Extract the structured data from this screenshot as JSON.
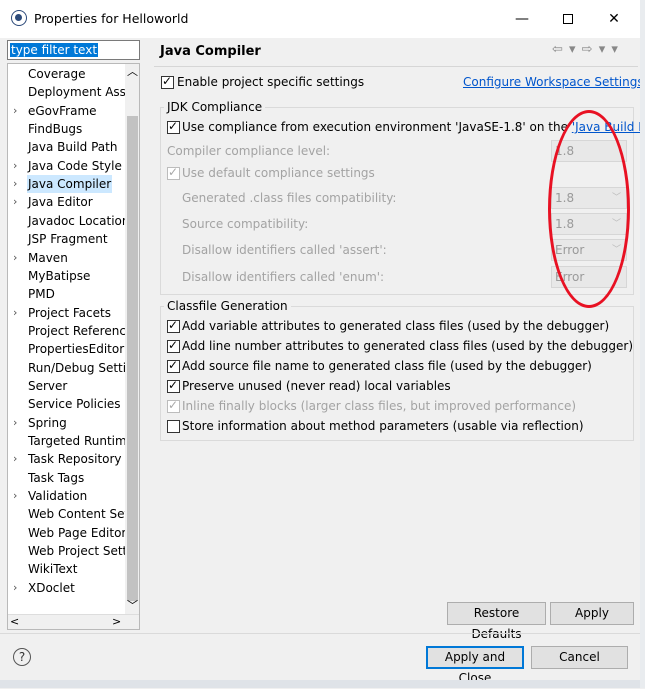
{
  "window": {
    "title": "Properties for Helloworld",
    "controls": {
      "minimize": "—",
      "maximize": "□",
      "close": "✕"
    }
  },
  "filter": {
    "value": "type filter text"
  },
  "tree": {
    "items": [
      {
        "label": "Coverage",
        "expandable": false
      },
      {
        "label": "Deployment Asser",
        "expandable": false
      },
      {
        "label": "eGovFrame",
        "expandable": true
      },
      {
        "label": "FindBugs",
        "expandable": false
      },
      {
        "label": "Java Build Path",
        "expandable": false
      },
      {
        "label": "Java Code Style",
        "expandable": true
      },
      {
        "label": "Java Compiler",
        "expandable": true,
        "selected": true
      },
      {
        "label": "Java Editor",
        "expandable": true
      },
      {
        "label": "Javadoc Location",
        "expandable": false
      },
      {
        "label": "JSP Fragment",
        "expandable": false
      },
      {
        "label": "Maven",
        "expandable": true
      },
      {
        "label": "MyBatipse",
        "expandable": false
      },
      {
        "label": "PMD",
        "expandable": false
      },
      {
        "label": "Project Facets",
        "expandable": true
      },
      {
        "label": "Project References",
        "expandable": false
      },
      {
        "label": "PropertiesEditor",
        "expandable": false
      },
      {
        "label": "Run/Debug Settin",
        "expandable": false
      },
      {
        "label": "Server",
        "expandable": false
      },
      {
        "label": "Service Policies",
        "expandable": false
      },
      {
        "label": "Spring",
        "expandable": true
      },
      {
        "label": "Targeted Runtime",
        "expandable": false
      },
      {
        "label": "Task Repository",
        "expandable": true
      },
      {
        "label": "Task Tags",
        "expandable": false
      },
      {
        "label": "Validation",
        "expandable": true
      },
      {
        "label": "Web Content Sett",
        "expandable": false
      },
      {
        "label": "Web Page Editor",
        "expandable": false
      },
      {
        "label": "Web Project Settir",
        "expandable": false
      },
      {
        "label": "WikiText",
        "expandable": false
      },
      {
        "label": "XDoclet",
        "expandable": true
      }
    ]
  },
  "page": {
    "title": "Java Compiler",
    "enable_specific": "Enable project specific settings",
    "configure_link": "Configure Workspace Settings...",
    "jdk": {
      "group_title": "JDK Compliance",
      "use_compliance_prefix": "Use compliance from execution environment 'JavaSE-1.8' on the ",
      "use_compliance_link": "'Java Build Path'",
      "compliance_level_label": "Compiler compliance level:",
      "compliance_level_value": "1.8",
      "use_default": "Use default compliance settings",
      "generated_label": "Generated .class files compatibility:",
      "generated_value": "1.8",
      "source_label": "Source compatibility:",
      "source_value": "1.8",
      "assert_label": "Disallow identifiers called 'assert':",
      "assert_value": "Error",
      "enum_label": "Disallow identifiers called 'enum':",
      "enum_value": "Error"
    },
    "classfile": {
      "group_title": "Classfile Generation",
      "opt1": "Add variable attributes to generated class files (used by the debugger)",
      "opt2": "Add line number attributes to generated class files (used by the debugger)",
      "opt3": "Add source file name to generated class file (used by the debugger)",
      "opt4": "Preserve unused (never read) local variables",
      "opt5": "Inline finally blocks (larger class files, but improved performance)",
      "opt6": "Store information about method parameters (usable via reflection)"
    },
    "restore_defaults": "Restore Defaults",
    "apply": "Apply"
  },
  "footer": {
    "help": "?",
    "apply_close": "Apply and Close",
    "cancel": "Cancel"
  },
  "colors": {
    "annotation": "#e81123",
    "selection": "#cce8ff",
    "link": "#0055cc"
  }
}
